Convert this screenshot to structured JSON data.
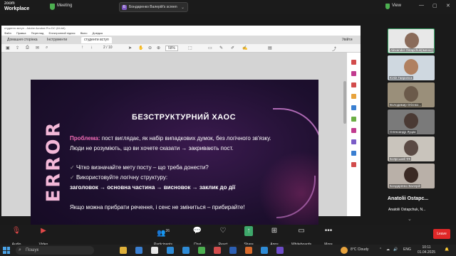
{
  "app": {
    "brand_top": "zoom",
    "brand_bottom": "Workplace",
    "meeting_label": "Meeting",
    "view_label": "View"
  },
  "share_indicator": {
    "initial": "Б",
    "label": "Бондаренко Валерій's screen"
  },
  "acrobat": {
    "title": "студенти вступ - Adobe Acrobat Pro DC (64-bit)",
    "menu": [
      "Файл",
      "Правка",
      "Перегляд",
      "Електронний підпис",
      "Вікно",
      "Довідка"
    ],
    "tabs": {
      "home": "Домашня сторінка",
      "tools": "Інструменти",
      "doc": "студенти вступ"
    },
    "page_current": "2",
    "page_total": "/ 10",
    "zoom": "58%",
    "share_btn": "Увійти"
  },
  "slide": {
    "side_word": "ERROR",
    "title": "БЕЗСТРУКТУРНИЙ ХАОС",
    "problem_label": "Проблема:",
    "problem_text": " пост виглядає, як набір випадкових думок, без логічного зв'язку.",
    "line2": "Люди не розуміють, що ви хочете сказати → закривають пост.",
    "check1": "Чітко визначайте мету посту – що треба донести?",
    "check2": "Використовуйте логічну структуру:",
    "structure": "заголовок → основна частина → висновок → заклик до дії",
    "closing": "Якщо можна прибрати речення, і сенс не зміниться – прибирайте!"
  },
  "participants": [
    {
      "name": "Alexander Ostapchuk(Іменко)"
    },
    {
      "name": "Юлія Гаврилюк"
    },
    {
      "name": "Володимир Огієнко..."
    },
    {
      "name": "Олександр Луцак"
    },
    {
      "name": "Боярський ФК"
    },
    {
      "name": "Бондаренко Валерій"
    }
  ],
  "active_speaker": {
    "name_big": "Anatolii Ostapc...",
    "name_small": "Anatolii Ostapchuk, N..."
  },
  "toolbar": {
    "audio": "Audio",
    "video": "Video",
    "participants": "Participants",
    "participants_count": "26",
    "chat": "Chat",
    "react": "React",
    "share": "Share",
    "apps": "Apps",
    "whiteboards": "Whiteboards",
    "more": "More",
    "leave": "Leave"
  },
  "taskbar": {
    "search_placeholder": "Пошук",
    "weather": "8°C Cloudy",
    "lang": "ENG",
    "time": "10:11",
    "date": "01.04.2025"
  }
}
